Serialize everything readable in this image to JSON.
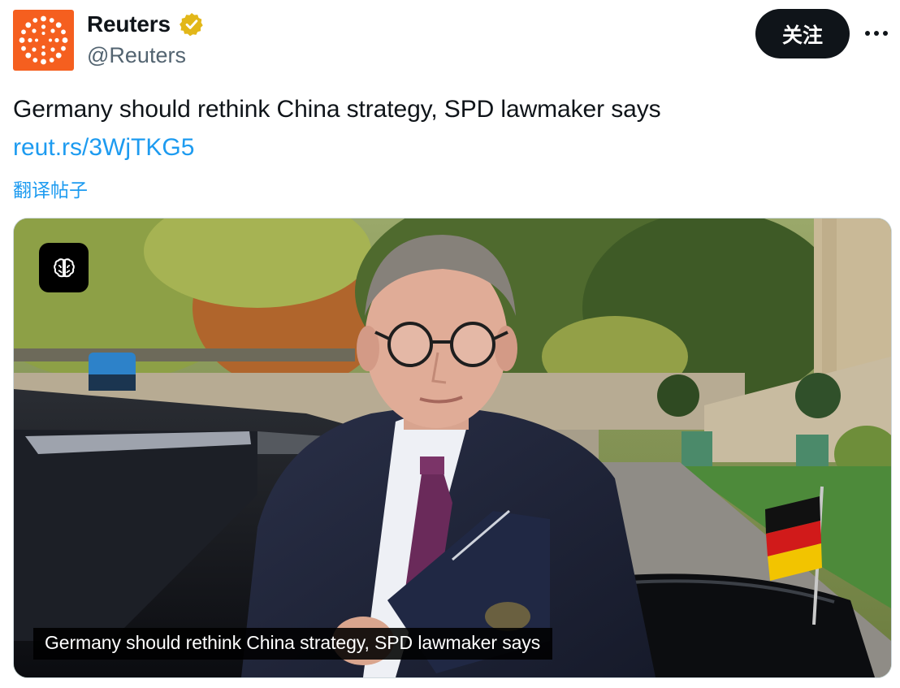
{
  "author": {
    "name": "Reuters",
    "handle": "@Reuters",
    "avatar_icon": "reuters-logo-icon",
    "avatar_color": "#f55f1f",
    "verified_icon": "verified-badge-icon",
    "verified_color": "#e2b719"
  },
  "actions": {
    "follow_label": "关注",
    "more_icon": "more-options-icon"
  },
  "post": {
    "text": "Germany should rethink China strategy, SPD lawmaker says",
    "link": "reut.rs/3WjTKG5",
    "translate_label": "翻译帖子",
    "link_color": "#1d9bf0"
  },
  "media": {
    "ai_badge_icon": "brain-icon",
    "caption": "Germany should rethink China strategy, SPD lawmaker says"
  }
}
